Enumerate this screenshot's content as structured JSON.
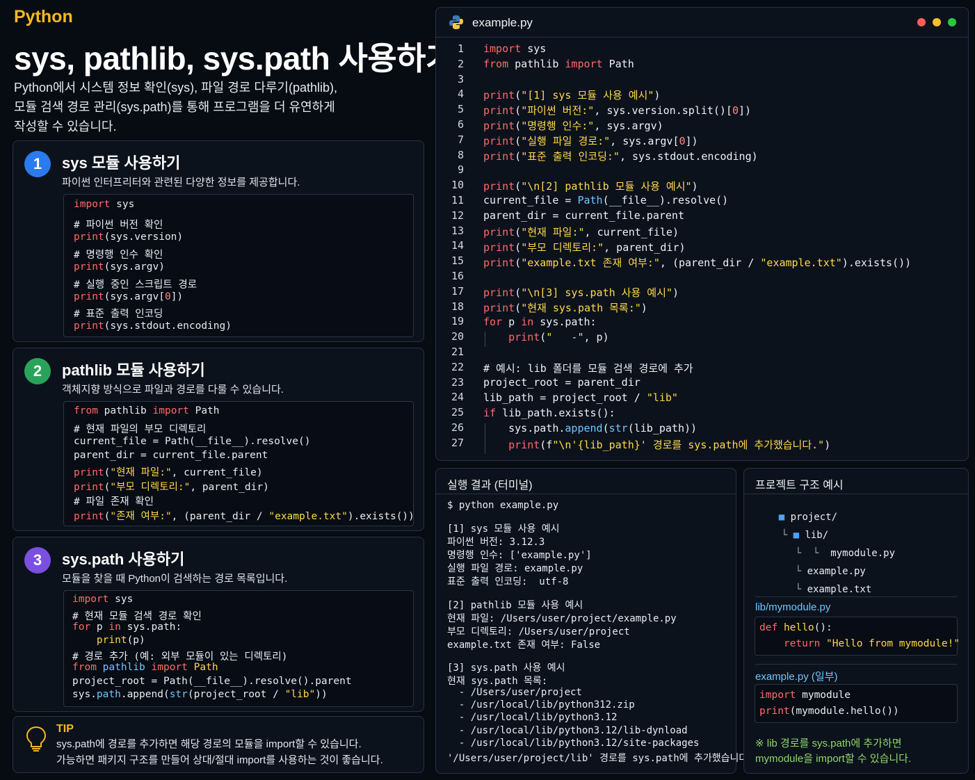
{
  "header": {
    "tag": "Python",
    "title": "sys, pathlib, sys.path 사용하기",
    "intro": [
      "Python에서 시스템 정보 확인(sys), 파일 경로 다루기(pathlib),",
      "모듈 검색 경로 관리(sys.path)를 통해 프로그램을 더 유연하게",
      "작성할 수 있습니다."
    ]
  },
  "sections": [
    {
      "number": "1",
      "title": "sys 모듈 사용하기",
      "desc": "파이썬 인터프리터와 관련된 다양한 정보를 제공합니다.",
      "color": "#2b7bf0",
      "code": [
        "import sys",
        "# 파이썬 버전 확인",
        "print(sys.version)",
        "# 명령행 인수 확인",
        "print(sys.argv)",
        "# 실행 중인 스크립트 경로",
        "print(sys.argv[0])",
        "# 표준 출력 인코딩",
        "print(sys.stdout.encoding)"
      ]
    },
    {
      "number": "2",
      "title": "pathlib 모듈 사용하기",
      "desc": "객체지향 방식으로 파일과 경로를 다룰 수 있습니다.",
      "color": "#2aa35a",
      "code": [
        "from pathlib import Path",
        "# 현재 파일의 부모 디렉토리",
        "current_file = Path(__file__).resolve()",
        "parent_dir = current_file.parent",
        "print(\"현재 파일:\", current_file)",
        "print(\"부모 디렉토리:\", parent_dir)",
        "# 파일 존재 확인",
        "print(\"존재 여부:\", (parent_dir / \"example.txt\").exists())"
      ]
    },
    {
      "number": "3",
      "title": "sys.path 사용하기",
      "desc": "모듈을 찾을 때 Python이 검색하는 경로 목록입니다.",
      "color": "#7b4fe0",
      "code": [
        "import sys",
        "# 현재 모듈 검색 경로 확인",
        "for p in sys.path:",
        "    print(p)",
        "# 경로 추가 (예: 외부 모듈이 있는 디렉토리)",
        "from pathlib import Path",
        "project_root = Path(__file__).resolve().parent",
        "sys.path.append(str(project_root / \"lib\"))"
      ]
    }
  ],
  "tip": {
    "label": "TIP",
    "lines": [
      "sys.path에 경로를 추가하면 해당 경로의 모듈을 import할 수 있습니다.",
      "가능하면 패키지 구조를 만들어 상대/절대 import를 사용하는 것이 좋습니다."
    ]
  },
  "editor": {
    "filename": "example.py",
    "lines": [
      "import sys",
      "from pathlib import Path",
      "",
      "print(\"[1] sys 모듈 사용 예시\")",
      "print(\"파이썬 버전:\", sys.version.split()[0])",
      "print(\"명령행 인수:\", sys.argv)",
      "print(\"실행 파일 경로:\", sys.argv[0])",
      "print(\"표준 출력 인코딩:\", sys.stdout.encoding)",
      "",
      "print(\"\\n[2] pathlib 모듈 사용 예시\")",
      "current_file = Path(__file__).resolve()",
      "parent_dir = current_file.parent",
      "print(\"현재 파일:\", current_file)",
      "print(\"부모 디렉토리:\", parent_dir)",
      "print(\"example.txt 존재 여부:\", (parent_dir / \"example.txt\").exists())",
      "",
      "print(\"\\n[3] sys.path 사용 예시\")",
      "print(\"현재 sys.path 목록:\")",
      "for p in sys.path:",
      "    print(\"   -\", p)",
      "",
      "# 예시: lib 폴더를 모듈 검색 경로에 추가",
      "project_root = parent_dir",
      "lib_path = project_root / \"lib\"",
      "if lib_path.exists():",
      "    sys.path.append(str(lib_path))",
      "    print(f\"\\n'{lib_path}' 경로를 sys.path에 추가했습니다.\")"
    ]
  },
  "terminal": {
    "title": "실행 결과 (터미널)",
    "command": "$ python example.py",
    "groups": [
      [
        "[1] sys 모듈 사용 예시",
        "파이썬 버전: 3.12.3",
        "명령행 인수: ['example.py']",
        "실행 파일 경로: example.py",
        "표준 출력 인코딩:  utf-8"
      ],
      [
        "[2] pathlib 모듈 사용 예시",
        "현재 파일: /Users/user/project/example.py",
        "부모 디렉토리: /Users/user/project",
        "example.txt 존재 여부: False"
      ],
      [
        "[3] sys.path 사용 예시",
        "현재 sys.path 목록:",
        "  - /Users/user/project",
        "  - /usr/local/lib/python312.zip",
        "  - /usr/local/lib/python3.12",
        "  - /usr/local/lib/python3.12/lib-dynload",
        "  - /usr/local/lib/python3.12/site-packages"
      ]
    ],
    "final": "'/Users/user/project/lib' 경로를 sys.path에 추가했습니다."
  },
  "structure": {
    "title": "프로젝트 구조 예시",
    "tree": [
      {
        "prefix": "",
        "icon": "folder",
        "name": "project/"
      },
      {
        "prefix": "└ ",
        "icon": "folder",
        "name": "lib/"
      },
      {
        "prefix": "  └  └   ",
        "icon": "",
        "name": "mymodule.py"
      },
      {
        "prefix": "  └ ",
        "icon": "",
        "name": "example.py"
      },
      {
        "prefix": "  └ ",
        "icon": "",
        "name": "example.txt"
      }
    ],
    "module_label": "lib/mymodule.py",
    "module_code": [
      "def hello():",
      "    return \"Hello from mymodule!\""
    ],
    "example_label": "example.py (일부)",
    "example_code": [
      "import mymodule",
      "print(mymodule.hello())"
    ],
    "note": [
      "※ lib 경로를 sys.path에 추가하면",
      "mymodule을 import할 수 있습니다."
    ]
  },
  "colors": {
    "accent": "#f5b820",
    "keyword": "#ff6b6b",
    "string": "#ffd94a",
    "builtin": "#6ec7ff"
  }
}
